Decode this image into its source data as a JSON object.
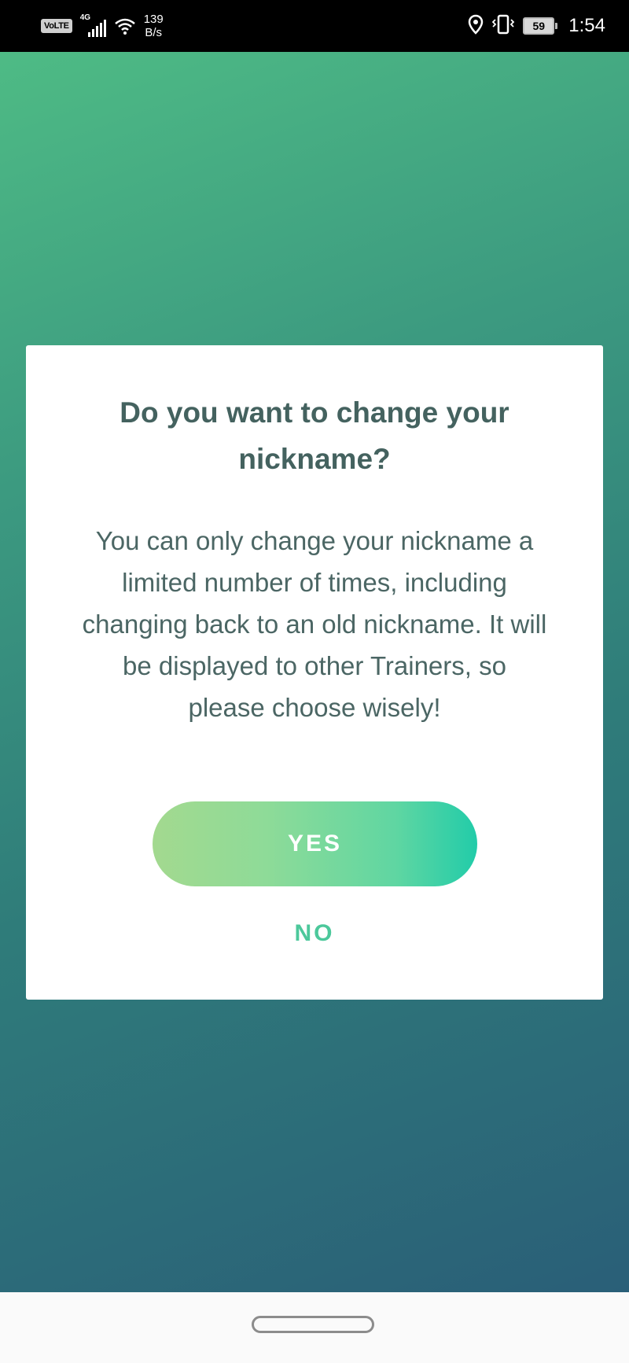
{
  "status_bar": {
    "volte": "VoLTE",
    "network": "4G",
    "speed_value": "139",
    "speed_unit": "B/s",
    "battery": "59",
    "time": "1:54"
  },
  "dialog": {
    "title": "Do you want to change your nickname?",
    "body": "You can only change your nickname a limited number of times, including changing back to an old nickname. It will be displayed to other Trainers, so please choose wisely!",
    "yes_label": "YES",
    "no_label": "NO"
  },
  "colors": {
    "accent": "#4cc89b",
    "title_text": "#44625f",
    "yes_gradient_start": "#a3d98f",
    "yes_gradient_end": "#22cca9"
  }
}
